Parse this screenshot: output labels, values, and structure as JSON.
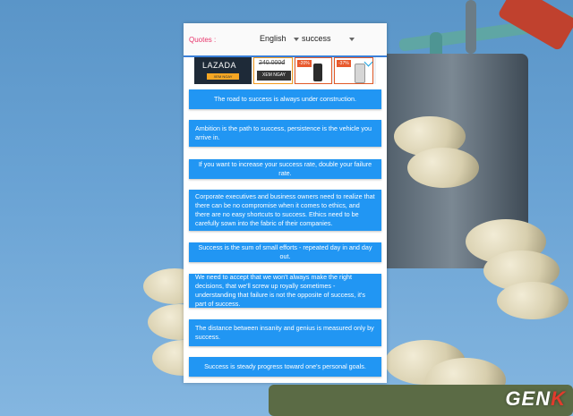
{
  "header": {
    "quotes_label": "Quotes :",
    "language": "English",
    "topic": "success"
  },
  "ad": {
    "brand": "LAZADA",
    "brand_cta": "XEM NGAY",
    "item1_price": "240.000đ",
    "item1_cta": "XEM NGAY",
    "item2_discount": "-20%",
    "item3_discount": "-37%"
  },
  "quotes": [
    "The road to success is always under construction.",
    "Ambition is the path to success, persistence is the vehicle you arrive in.",
    "If you want to increase your success rate, double your failure rate.",
    "Corporate executives and business owners need to realize that there can be no compromise when it comes to ethics, and there are no easy shortcuts to success. Ethics need to be carefully sown into the fabric of their companies.",
    "Success is the sum of small efforts - repeated day in and day out.",
    "We need to accept that we won't always make the right decisions, that we'll screw up royally sometimes - understanding that failure is not the opposite of success, it's part of success.",
    "The distance between insanity and genius is measured only by success.",
    "Success is steady progress toward one's personal goals."
  ],
  "watermark": {
    "prefix": "GEN",
    "accent": "K"
  },
  "colors": {
    "quote_bg": "#2196f3",
    "label_pink": "#e8356b",
    "accent_blue": "#3a7fd8"
  }
}
